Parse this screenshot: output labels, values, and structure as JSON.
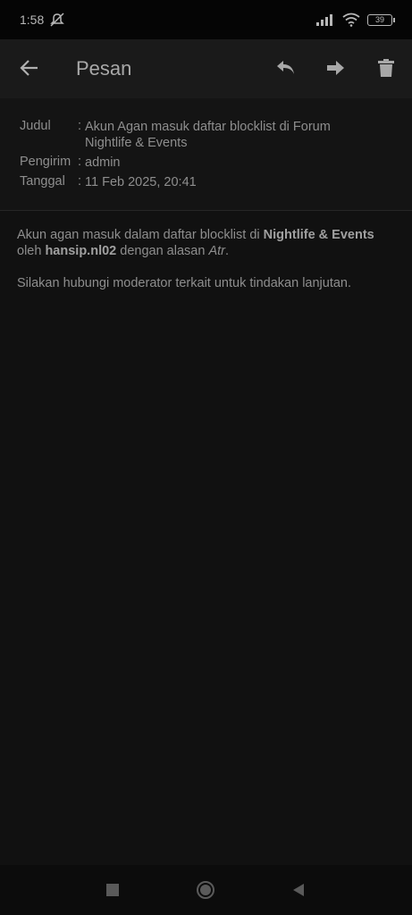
{
  "status": {
    "time": "1:58",
    "battery": "39"
  },
  "appbar": {
    "title": "Pesan",
    "icons": [
      "back-arrow-icon",
      "reply-icon",
      "forward-icon",
      "trash-icon"
    ]
  },
  "detail": {
    "subject_label": "Judul",
    "subject_value": "Akun Agan masuk daftar blocklist di Forum Nightlife & Events",
    "sender_label": "Pengirim",
    "sender_value": "admin",
    "date_label": "Tanggal",
    "date_value": "11 Feb 2025, 20:41",
    "separator": ":"
  },
  "message": {
    "p1_a": "Akun agan masuk dalam daftar blocklist di ",
    "p1_forum": "Nightlife & Events",
    "p1_b": " oleh ",
    "p1_user": "hansip.nl02",
    "p1_c": " dengan alasan ",
    "p1_reason": "Atr",
    "p1_d": ".",
    "p2": "Silakan hubungi moderator terkait untuk tindakan lanjutan."
  },
  "nav": {
    "icons": [
      "recent-apps-icon",
      "home-icon",
      "back-icon"
    ]
  }
}
